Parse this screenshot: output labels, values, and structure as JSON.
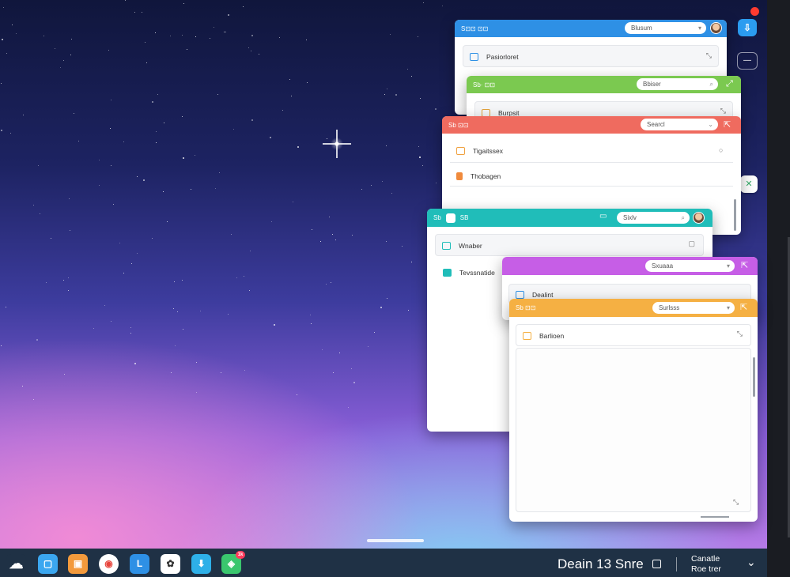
{
  "desktop": {
    "accent_colors": {
      "blue": "#2e90e5",
      "green": "#7bc950",
      "red": "#ef6b5f",
      "teal": "#20bdb9",
      "purple": "#c65ee6",
      "orange": "#f5b043"
    }
  },
  "windows": {
    "blue": {
      "tab_label": "S⊡⊡ ⊡⊡",
      "search_text": "Blusum",
      "item1": "Pasiorloret"
    },
    "green": {
      "tab_label": "Sb· ⊡⊡",
      "search_text": "Bbiser",
      "item1": "Burpsit"
    },
    "red": {
      "tab_label": "Sb ⊡⊡",
      "search_text": "Searcl",
      "item1": "Tigaitssex",
      "item2": "Thobagen"
    },
    "teal": {
      "tab_label": "SB",
      "search_text": "Sixlv",
      "item1": "Wnaber",
      "item2": "Tevssnatide"
    },
    "purple": {
      "search_text": "Sxuaaa",
      "item1": "Dealint"
    },
    "orange": {
      "tab_label": "Sb ⊡⊡",
      "search_text": "Surlsss",
      "item1": "Barlioen"
    }
  },
  "taskbar": {
    "apps": [
      {
        "name": "cloud-app-icon",
        "glyph": "☁"
      },
      {
        "name": "messages-app-icon",
        "glyph": "▢"
      },
      {
        "name": "presentation-app-icon",
        "glyph": "▣"
      },
      {
        "name": "chrome-app-icon",
        "glyph": "◉"
      },
      {
        "name": "planner-app-icon",
        "glyph": "L"
      },
      {
        "name": "ai-app-icon",
        "glyph": "✿"
      },
      {
        "name": "downloads-app-icon",
        "glyph": "⬇"
      },
      {
        "name": "store-app-icon",
        "glyph": "◈",
        "badge": "1k"
      }
    ],
    "clock": "Deain 13 Snre",
    "tray_line1": "Canatle",
    "tray_line2": "Roe trer"
  }
}
